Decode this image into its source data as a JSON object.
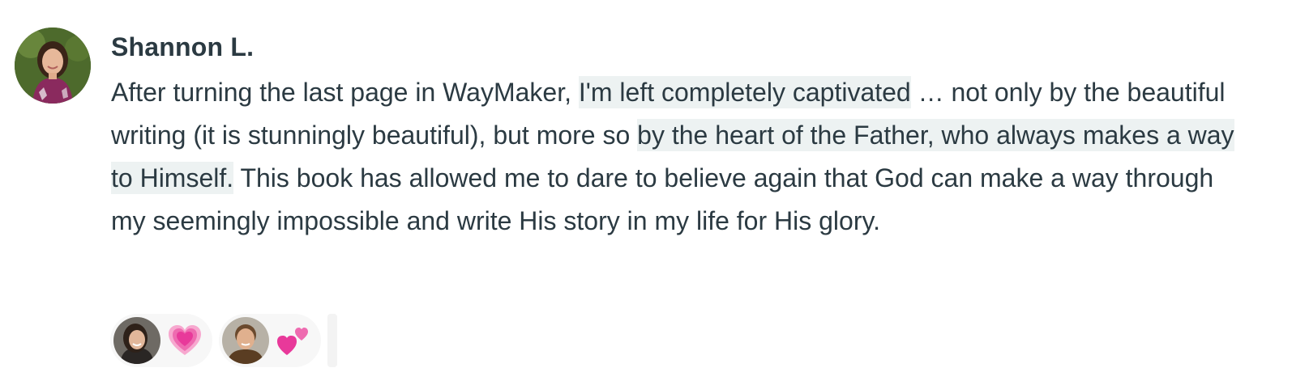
{
  "comment": {
    "author": "Shannon L.",
    "text_segments": [
      {
        "text": "After turning the last page in WayMaker, ",
        "highlight": false
      },
      {
        "text": "I'm left completely captivated",
        "highlight": true
      },
      {
        "text": " … not only by the beautiful writing (it is stunningly beautiful), but more so ",
        "highlight": false
      },
      {
        "text": "by the heart of the Father, who always makes a way to Himself.",
        "highlight": true
      },
      {
        "text": " This book has allowed me to dare to believe again that God can make a way through my seemingly impossible and write His story in my life for His glory.",
        "highlight": false
      }
    ]
  },
  "reactions": [
    {
      "emoji": "growing-heart-icon",
      "avatar": "user-avatar-woman"
    },
    {
      "emoji": "two-hearts-icon",
      "avatar": "user-avatar-man"
    }
  ],
  "colors": {
    "text": "#2b3a42",
    "highlight": "#edf2f2",
    "reaction_bg": "#f7f7f7",
    "heart": "#e8399a"
  }
}
